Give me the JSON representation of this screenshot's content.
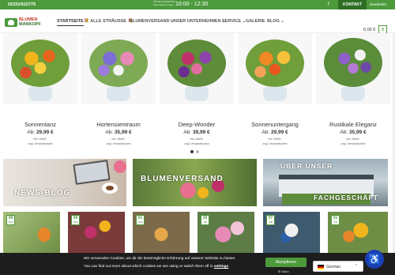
{
  "topbar": {
    "phone": "02331/615775",
    "hours_label": "ÖFFNUNGSZEITEN\nSamstagssonntags",
    "hours": "10:00 - 12:30",
    "kontakt": "KONTAKT",
    "newsletter": "Newsletter"
  },
  "logo": {
    "line1": "BLUMEN",
    "line2": "MANKOPF"
  },
  "nav": {
    "items": [
      {
        "label": "STARTSEITE"
      },
      {
        "label": "💐 ALLE STRÄUSSE 💐"
      },
      {
        "label": "BLUMENVERSAND ⌄"
      },
      {
        "label": "UNSER UNTERNEHMEN ⌄"
      },
      {
        "label": "SERVICE ⌄"
      },
      {
        "label": "GALERIE"
      },
      {
        "label": "BLOG ⌄"
      }
    ],
    "cart_total": "0,00 €",
    "cart_count": "0"
  },
  "products": [
    {
      "name": "Sonnentanz",
      "price_prefix": "Ab:",
      "price": "29,99 €",
      "tax": "inkl. MwSt.",
      "ship": "zzgl. Versandkosten"
    },
    {
      "name": "Hortensientraum",
      "price_prefix": "Ab:",
      "price": "35,99 €",
      "tax": "inkl. MwSt.",
      "ship": "zzgl. Versandkosten"
    },
    {
      "name": "Deep-Wonder",
      "price_prefix": "Ab:",
      "price": "39,99 €",
      "tax": "inkl. MwSt.",
      "ship": "zzgl. Versandkosten"
    },
    {
      "name": "Sonnenuntergang",
      "price_prefix": "Ab:",
      "price": "29,99 €",
      "tax": "inkl. MwSt.",
      "ship": "zzgl. Versandkosten"
    },
    {
      "name": "Rustikale Eleganz",
      "price_prefix": "Ab:",
      "price": "35,99 €",
      "tax": "inkl. MwSt.",
      "ship": "zzgl. Versandkosten"
    }
  ],
  "banners": [
    {
      "title": "NEWS-BLOG"
    },
    {
      "title": "BLUMENVERSAND"
    },
    {
      "title": "ÜBER UNSER",
      "title2": "FACHGESCHÄFT"
    }
  ],
  "blog_tiles": [
    {
      "day": "09",
      "month": "Sep"
    },
    {
      "day": "09",
      "month": "Sep"
    },
    {
      "day": "01",
      "month": "Aug"
    },
    {
      "day": "20",
      "month": "Juli"
    },
    {
      "day": "07",
      "month": "Juli"
    },
    {
      "day": "01",
      "month": "Juli"
    }
  ],
  "cookie": {
    "line1": "Wir verwenden Cookies, um dir die bestmögliche Erfahrung auf unserer Website zu bieten.",
    "line2": "You can find out more about which cookies we are using or switch them off in",
    "settings_link": "settings",
    "accept": "Akzeptieren",
    "more": "⚙ Mehr"
  },
  "language": {
    "label": "German",
    "chevron": "⌃"
  },
  "colors": {
    "brand_green": "#4c9a3c",
    "dark_green": "#2f6e25",
    "cookie_bg": "#1d1d1d",
    "a11y_blue": "#1a3fb5"
  }
}
